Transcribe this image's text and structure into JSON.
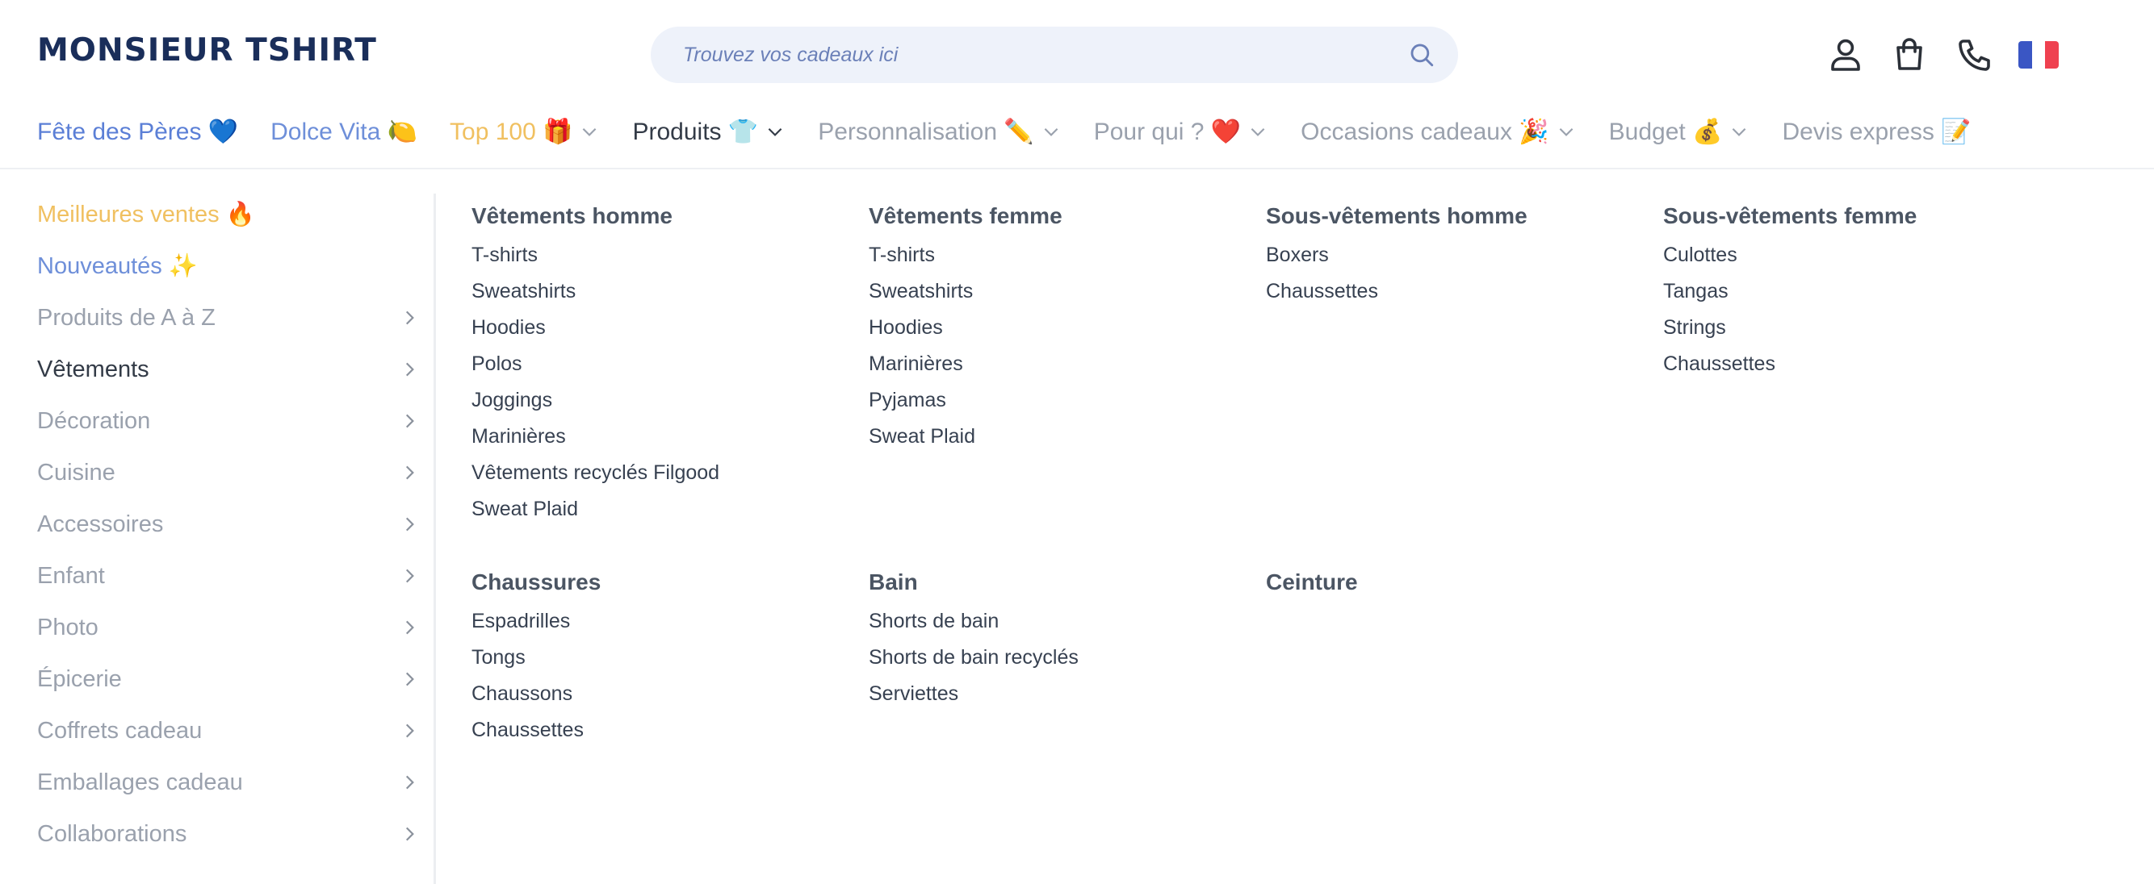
{
  "header": {
    "logo": "MONSIEUR TSHIRT",
    "search_placeholder": "Trouvez vos cadeaux ici",
    "icons": [
      "user-icon",
      "bag-icon",
      "phone-icon",
      "france-flag-icon"
    ]
  },
  "nav": {
    "items": [
      {
        "label": "Fête des Pères 💙",
        "color": "#5b7fd6",
        "dropdown": false
      },
      {
        "label": "Dolce Vita 🍋",
        "color": "#6e8fd9",
        "dropdown": false
      },
      {
        "label": "Top 100 🎁",
        "color": "#f0c060",
        "dropdown": true
      },
      {
        "label": "Produits 👕",
        "color": "#333b47",
        "dropdown": true
      },
      {
        "label": "Personnalisation ✏️",
        "color": "#9aa1ad",
        "dropdown": true
      },
      {
        "label": "Pour qui ? ❤️",
        "color": "#9aa1ad",
        "dropdown": true
      },
      {
        "label": "Occasions cadeaux 🎉",
        "color": "#9aa1ad",
        "dropdown": true
      },
      {
        "label": "Budget 💰",
        "color": "#9aa1ad",
        "dropdown": true
      },
      {
        "label": "Devis express 📝",
        "color": "#9aa1ad",
        "dropdown": false
      }
    ]
  },
  "sidebar": {
    "items": [
      {
        "label": "Meilleures ventes 🔥",
        "color": "#f0c060",
        "arrow": false
      },
      {
        "label": "Nouveautés ✨",
        "color": "#6e8fd9",
        "arrow": false
      },
      {
        "label": "Produits de A à Z",
        "color": "#9aa1ad",
        "arrow": true
      },
      {
        "label": "Vêtements",
        "color": "#333b47",
        "arrow": true
      },
      {
        "label": "Décoration",
        "color": "#9aa1ad",
        "arrow": true
      },
      {
        "label": "Cuisine",
        "color": "#9aa1ad",
        "arrow": true
      },
      {
        "label": "Accessoires",
        "color": "#9aa1ad",
        "arrow": true
      },
      {
        "label": "Enfant",
        "color": "#9aa1ad",
        "arrow": true
      },
      {
        "label": "Photo",
        "color": "#9aa1ad",
        "arrow": true
      },
      {
        "label": "Épicerie",
        "color": "#9aa1ad",
        "arrow": true
      },
      {
        "label": "Coffrets cadeau",
        "color": "#9aa1ad",
        "arrow": true
      },
      {
        "label": "Emballages cadeau",
        "color": "#9aa1ad",
        "arrow": true
      },
      {
        "label": "Collaborations",
        "color": "#9aa1ad",
        "arrow": true
      }
    ]
  },
  "columns": [
    {
      "title": "Vêtements homme",
      "items": [
        "T-shirts",
        "Sweatshirts",
        "Hoodies",
        "Polos",
        "Joggings",
        "Marinières",
        "Vêtements recyclés Filgood",
        "Sweat Plaid"
      ]
    },
    {
      "title": "Vêtements femme",
      "items": [
        "T-shirts",
        "Sweatshirts",
        "Hoodies",
        "Marinières",
        "Pyjamas",
        "Sweat Plaid"
      ]
    },
    {
      "title": "Sous-vêtements homme",
      "items": [
        "Boxers",
        "Chaussettes"
      ]
    },
    {
      "title": "Sous-vêtements femme",
      "items": [
        "Culottes",
        "Tangas",
        "Strings",
        "Chaussettes"
      ]
    },
    {
      "title": "Chaussures",
      "items": [
        "Espadrilles",
        "Tongs",
        "Chaussons",
        "Chaussettes"
      ]
    },
    {
      "title": "Bain",
      "items": [
        "Shorts de bain",
        "Shorts de bain recyclés",
        "Serviettes"
      ]
    },
    {
      "title": "Ceinture",
      "items": []
    }
  ],
  "colors": {
    "logo": "#1a2e5a",
    "search_bg": "#eef2fa",
    "flag": [
      "#3a56c4",
      "#ffffff",
      "#ef4150"
    ]
  }
}
